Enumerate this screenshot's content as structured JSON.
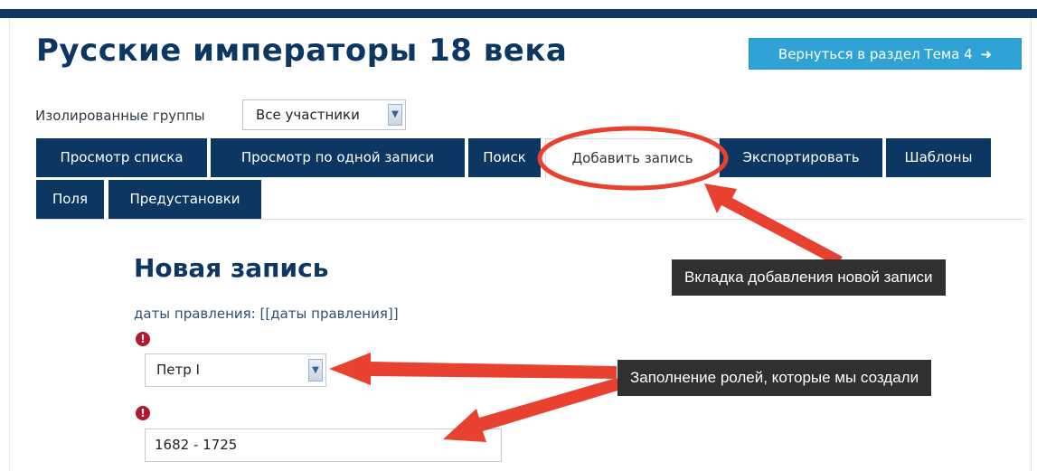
{
  "page": {
    "title": "Русские императоры 18 века",
    "return_button": "Вернуться в раздел Тема 4",
    "return_icon": "sign-in-icon"
  },
  "groups": {
    "label": "Изолированные группы",
    "selected": "Все участники"
  },
  "tabs": [
    {
      "label": "Просмотр списка",
      "active": false
    },
    {
      "label": "Просмотр по одной записи",
      "active": false
    },
    {
      "label": "Поиск",
      "active": false
    },
    {
      "label": "Добавить запись",
      "active": true
    },
    {
      "label": "Экспортировать",
      "active": false
    },
    {
      "label": "Шаблоны",
      "active": false
    },
    {
      "label": "Поля",
      "active": false
    },
    {
      "label": "Предустановки",
      "active": false
    }
  ],
  "form": {
    "heading": "Новая запись",
    "dates_label": "даты правления:",
    "dates_placeholder": "[[даты правления]]",
    "required_icon": "!",
    "ruler_selected": "Петр I",
    "reign_value": "1682 - 1725"
  },
  "annotations": {
    "tab_callout": "Вкладка добавления новой записи",
    "roles_callout": "Заполнение ролей, которые мы создали",
    "accent_color": "#e8412f"
  }
}
